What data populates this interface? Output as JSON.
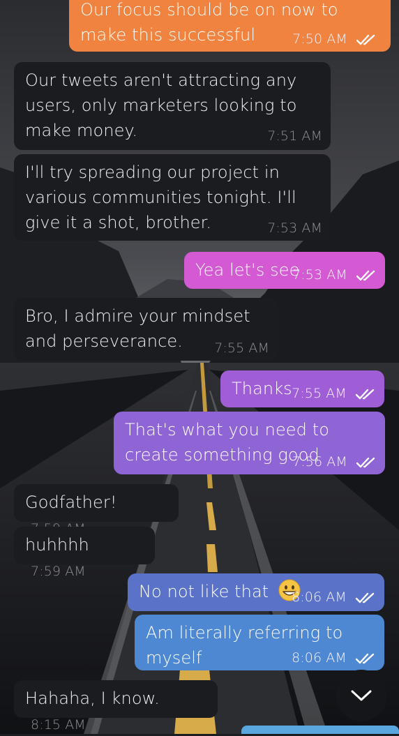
{
  "colors": {
    "orange": "#f08340",
    "pink": "#d35ad3",
    "purple": "#9c5ed5",
    "purple_light": "#8f64d4",
    "indigo": "#5a73c9",
    "blue": "#4e87d2",
    "incoming": "#1b1c20"
  },
  "messages": [
    {
      "dir": "out",
      "text": "Our focus should be on now to make this successful",
      "time": "7:50 AM",
      "read": true
    },
    {
      "dir": "in",
      "text": "Our tweets aren't attracting any users, only marketers looking to make money.",
      "time": "7:51 AM"
    },
    {
      "dir": "in",
      "text": "I'll try spreading our project in various communities tonight. I'll give it a shot, brother.",
      "time": "7:53 AM"
    },
    {
      "dir": "out",
      "text": "Yea let's see",
      "time": "7:53 AM",
      "read": true
    },
    {
      "dir": "in",
      "text": "Bro, I admire your mindset and perseverance.",
      "time": "7:55 AM"
    },
    {
      "dir": "out",
      "text": "Thanks",
      "time": "7:55 AM",
      "read": true
    },
    {
      "dir": "out",
      "text": "That's what you need to create something good",
      "time": "7:56 AM",
      "read": true
    },
    {
      "dir": "in",
      "text": "Godfather!",
      "time": "7:59 AM"
    },
    {
      "dir": "in",
      "text": "huhhhh",
      "time": "7:59 AM"
    },
    {
      "dir": "out",
      "text": "No not like that",
      "emoji": "grinning-face-emoji",
      "time": "8:06 AM",
      "read": true
    },
    {
      "dir": "out",
      "text": "Am literally referring to myself",
      "time": "8:06 AM",
      "read": true
    },
    {
      "dir": "in",
      "text": "Hahaha, I know.",
      "time": "8:15 AM"
    }
  ],
  "scroll_button": {
    "icon": "chevron-down-icon"
  }
}
